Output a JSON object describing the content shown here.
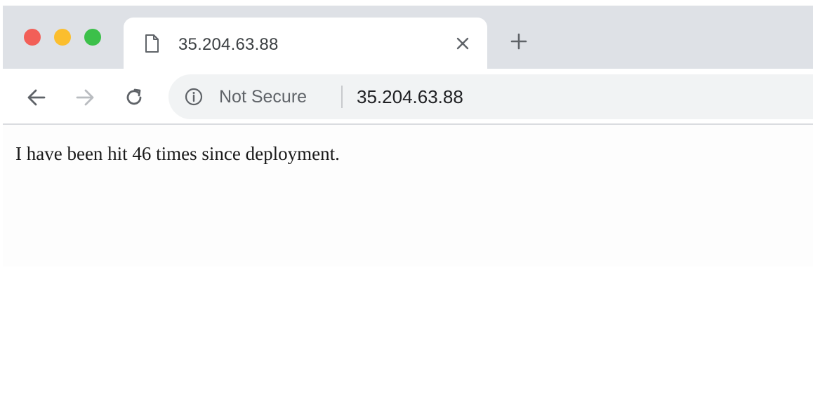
{
  "window": {
    "controls": [
      "close",
      "minimize",
      "zoom"
    ],
    "colors": {
      "close": "#f25f58",
      "minimize": "#fbbe2e",
      "zoom": "#3cc04a"
    }
  },
  "tab": {
    "title": "35.204.63.88",
    "icon": "document-icon",
    "close_icon": "close-icon"
  },
  "new_tab_icon": "plus-icon",
  "toolbar": {
    "back_icon": "arrow-left-icon",
    "forward_icon": "arrow-right-icon",
    "reload_icon": "reload-icon",
    "security_icon": "info-icon",
    "security_label": "Not Secure",
    "url": "35.204.63.88"
  },
  "page": {
    "body_text": "I have been hit 46 times since deployment."
  }
}
